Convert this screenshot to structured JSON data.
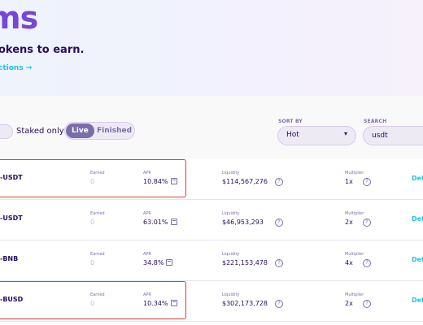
{
  "hero": {
    "title": "ms",
    "subtitle": "okens to earn.",
    "link": "ctions →"
  },
  "filters": {
    "staked_only_label": "Staked only",
    "staked_only_on": false,
    "tabs": [
      "Live",
      "Finished"
    ],
    "active_tab": "Live",
    "sort_by_label": "SORT BY",
    "sort_value": "Hot",
    "search_label": "SEARCH",
    "search_value": "usdt"
  },
  "labels": {
    "earned": "Earned",
    "apr": "APR",
    "liquidity": "Liquidity",
    "multiplier": "Multiplier",
    "details": "Det"
  },
  "colors": {
    "accent": "#7645d9",
    "text": "#280d5f",
    "secondary": "#7a6eaa",
    "link": "#1fc7d4",
    "highlight": "#e53935"
  },
  "farms": [
    {
      "name": "-USDT",
      "earned": "0",
      "apr": "10.84%",
      "liquidity": "$114,567,276",
      "multiplier": "1x",
      "highlighted": true
    },
    {
      "name": "-USDT",
      "earned": "0",
      "apr": "63.01%",
      "liquidity": "$46,953,293",
      "multiplier": "2x",
      "highlighted": false
    },
    {
      "name": "-BNB",
      "earned": "0",
      "apr": "34.8%",
      "liquidity": "$221,153,478",
      "multiplier": "4x",
      "highlighted": false
    },
    {
      "name": "-BUSD",
      "earned": "0",
      "apr": "10.34%",
      "liquidity": "$302,173,728",
      "multiplier": "2x",
      "highlighted": true
    }
  ]
}
